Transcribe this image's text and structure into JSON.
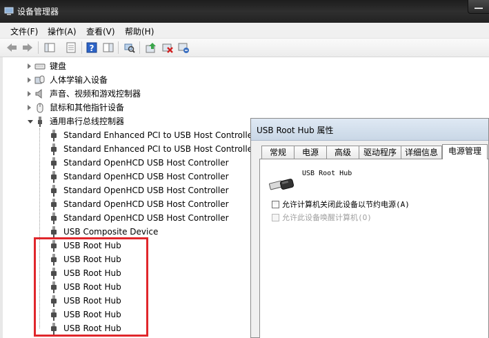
{
  "window": {
    "title": "设备管理器"
  },
  "menu": [
    "文件(F)",
    "操作(A)",
    "查看(V)",
    "帮助(H)"
  ],
  "toolbar": [
    "back-icon",
    "forward-icon",
    "console-tree-icon",
    "properties-icon",
    "help-icon",
    "show-action-icon",
    "scan-hardware-icon",
    "update-driver-icon",
    "uninstall-icon",
    "disable-icon"
  ],
  "tree": {
    "categories": [
      {
        "label": "键盘",
        "icon": "keyboard-icon",
        "expanded": false
      },
      {
        "label": "人体学输入设备",
        "icon": "hid-icon",
        "expanded": false
      },
      {
        "label": "声音、视频和游戏控制器",
        "icon": "speaker-icon",
        "expanded": false
      },
      {
        "label": "鼠标和其他指针设备",
        "icon": "mouse-icon",
        "expanded": false
      },
      {
        "label": "通用串行总线控制器",
        "icon": "usb-controller-icon",
        "expanded": true
      }
    ],
    "usb_devices": [
      "Standard Enhanced PCI to USB Host Controller",
      "Standard Enhanced PCI to USB Host Controller",
      "Standard OpenHCD USB Host Controller",
      "Standard OpenHCD USB Host Controller",
      "Standard OpenHCD USB Host Controller",
      "Standard OpenHCD USB Host Controller",
      "Standard OpenHCD USB Host Controller",
      "USB Composite Device",
      "USB Root Hub",
      "USB Root Hub",
      "USB Root Hub",
      "USB Root Hub",
      "USB Root Hub",
      "USB Root Hub",
      "USB Root Hub"
    ],
    "highlight_color": "#e0262b"
  },
  "dialog": {
    "title": "USB Root Hub 属性",
    "tabs": [
      "常规",
      "电源",
      "高级",
      "驱动程序",
      "详细信息",
      "电源管理"
    ],
    "active_tab": "电源管理",
    "device_name": "USB Root Hub",
    "options": [
      {
        "label": "允许计算机关闭此设备以节约电源(A)",
        "checked": false,
        "enabled": true
      },
      {
        "label": "允许此设备唤醒计算机(O)",
        "checked": false,
        "enabled": false
      }
    ]
  }
}
